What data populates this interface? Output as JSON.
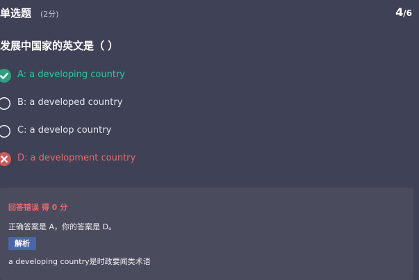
{
  "header": {
    "question_type": "单选题",
    "score": "(2分)",
    "progress_current": "4",
    "progress_total": "/6"
  },
  "question": {
    "text": "发展中国家的英文是（  ）"
  },
  "options": [
    {
      "label": "A: a developing country",
      "state": "correct",
      "icon": "check-circle-icon"
    },
    {
      "label": "B: a developed country",
      "state": "unselected",
      "icon": "radio-empty-icon"
    },
    {
      "label": "C: a develop country",
      "state": "unselected",
      "icon": "radio-empty-icon"
    },
    {
      "label": "D: a development country",
      "state": "wrong",
      "icon": "cross-circle-icon"
    }
  ],
  "result": {
    "title": "回答错误 得 0 分",
    "answer_line": "正确答案是 A，你的答案是 D。",
    "analysis_button": "解析",
    "analysis_text": "a developing country是时政要闻类术语"
  },
  "colors": {
    "background": "#3f4156",
    "panel": "#4a4b5d",
    "correct": "#2ec79f",
    "wrong": "#e86b6b",
    "button": "#4a65a8"
  }
}
